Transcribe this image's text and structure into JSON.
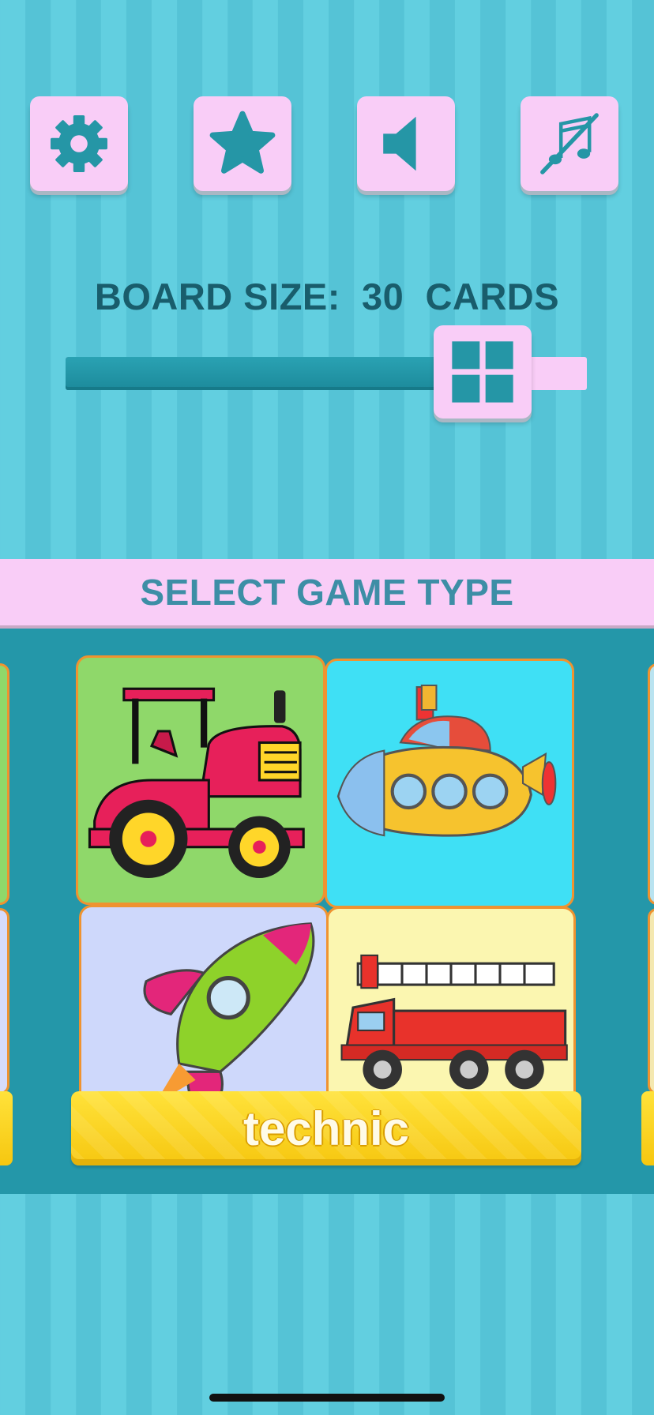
{
  "toolbar": {
    "settings_icon": "gear-icon",
    "favorites_icon": "star-icon",
    "sound_icon": "speaker-icon",
    "music_icon": "music-off-icon"
  },
  "board_size": {
    "prefix": "BOARD SIZE:",
    "value": "30",
    "unit": "CARDS",
    "slider_fraction": 0.8,
    "thumb_icon": "grid-icon"
  },
  "select_banner": {
    "title": "SELECT GAME TYPE"
  },
  "game_type": {
    "current_label": "technic",
    "preview_items": [
      "tractor",
      "submarine",
      "rocket",
      "fire-truck"
    ]
  },
  "colors": {
    "background": "#62cfe0",
    "button_pink": "#f9cdf7",
    "icon_teal": "#2596a6",
    "label_text": "#195d6c",
    "banner_text": "#3d8ea6",
    "game_area": "#2497a9",
    "label_bar": "#ffd928"
  }
}
